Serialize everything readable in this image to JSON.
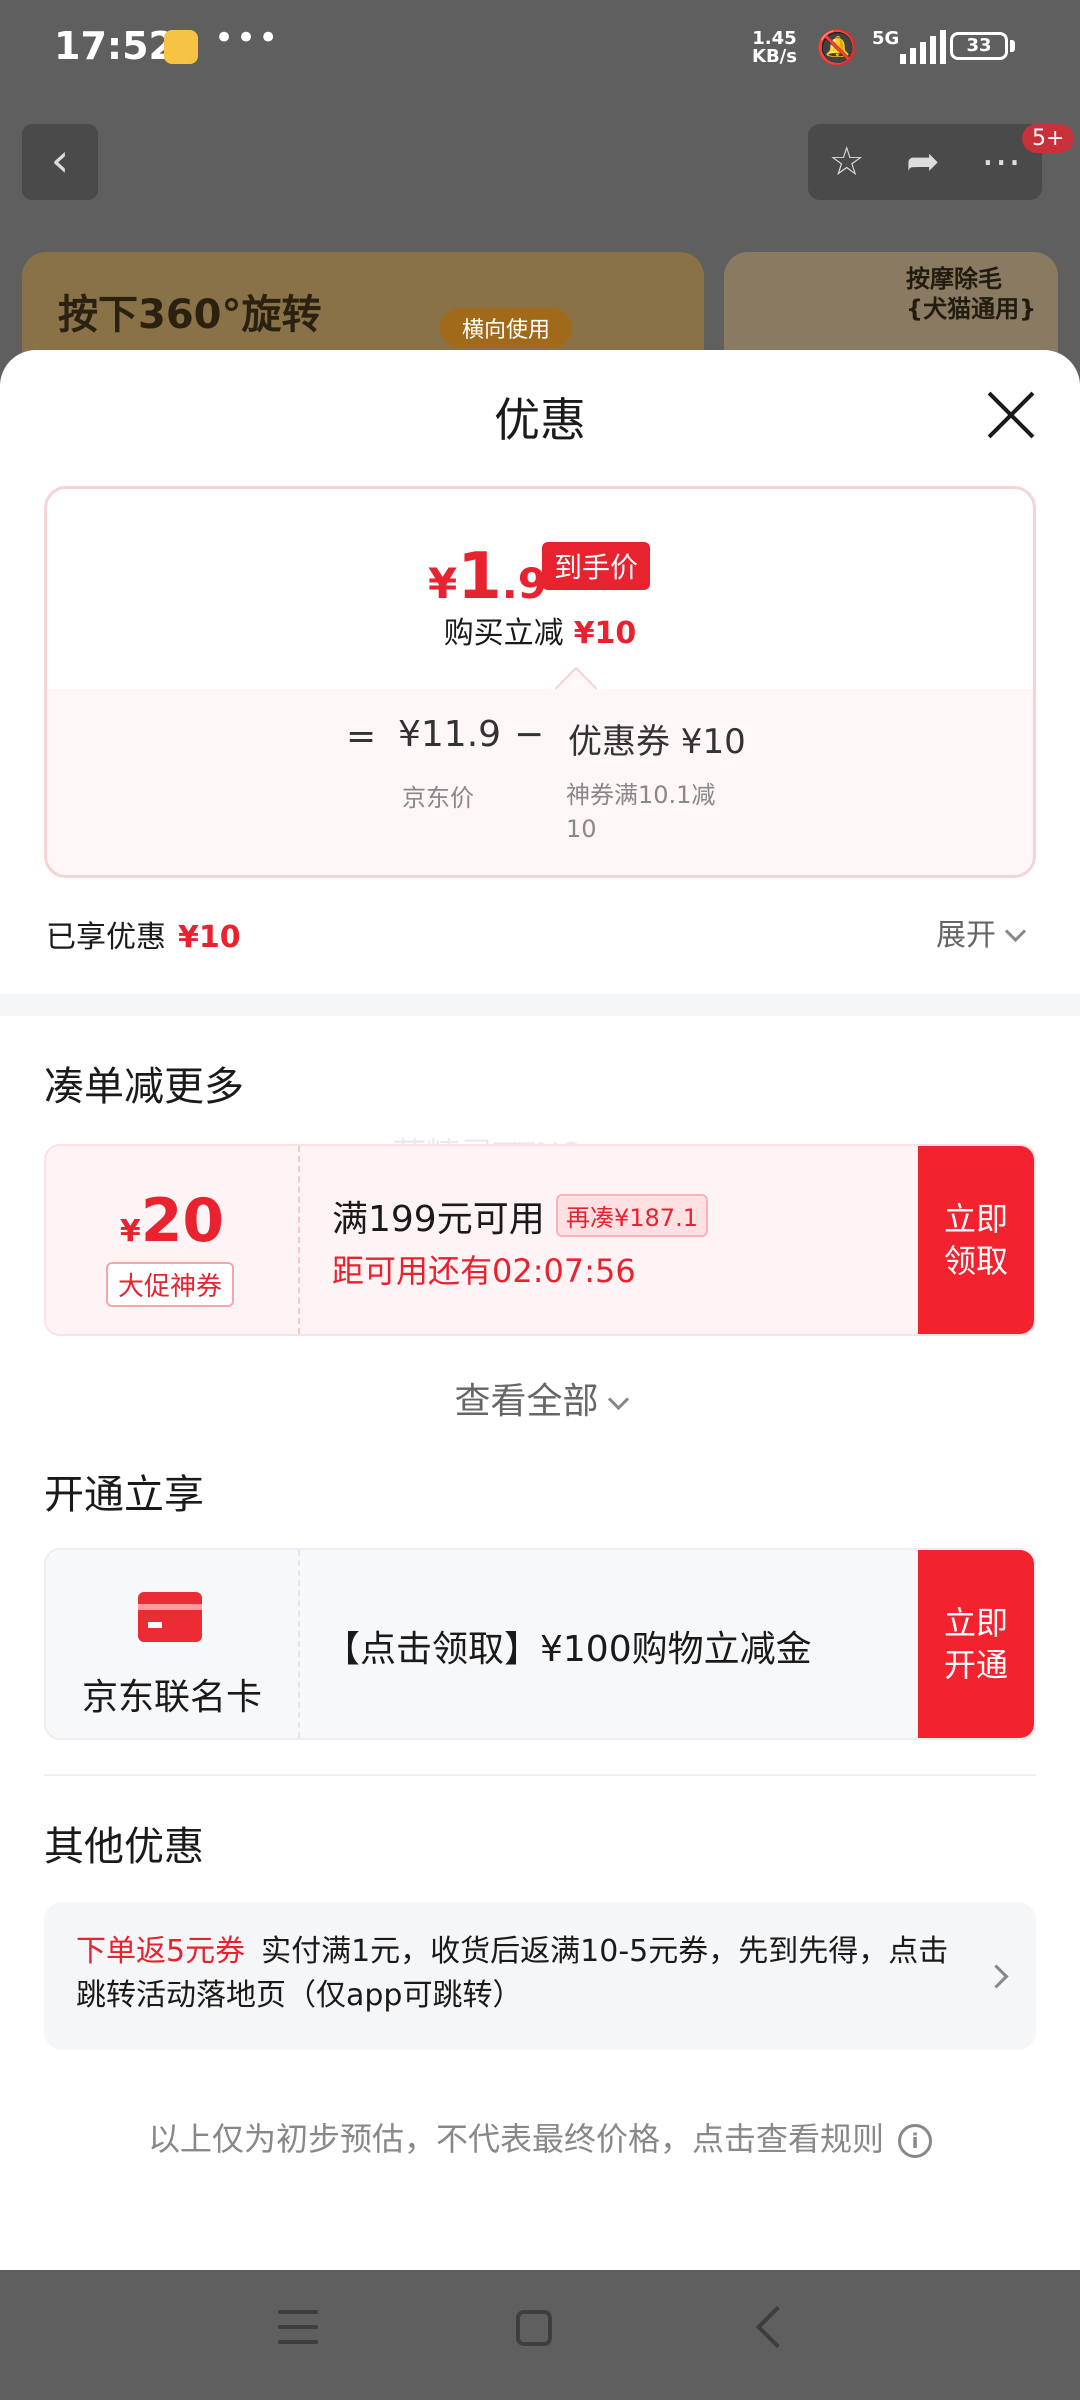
{
  "status_bar": {
    "time": "17:52",
    "net_speed_top": "1.45",
    "net_speed_bottom": "KB/s",
    "network": "5G",
    "battery": "33"
  },
  "background_page": {
    "banner_left_text": "按下360°旋转",
    "banner_left_tag": "横向使用",
    "banner_right_line1": "按摩除毛",
    "banner_right_line2": "{犬猫通用}",
    "notification_badge": "5+"
  },
  "sheet": {
    "title": "优惠",
    "final_price": {
      "currency": "¥",
      "integer": "1",
      "decimal": ".9",
      "tag": "到手价",
      "instant_cut_label": "购买立减",
      "instant_cut_value": "¥10"
    },
    "calc": {
      "equals": "=",
      "base_price": "¥11.9",
      "minus": "−",
      "coupon": "优惠券 ¥10",
      "base_price_label": "京东价",
      "coupon_desc": "神券满10.1减10"
    },
    "enjoyed_label": "已享优惠",
    "enjoyed_value": "¥10",
    "expand_label": "展开",
    "section_more": {
      "title": "凑单减更多",
      "coupon": {
        "currency": "¥",
        "amount": "20",
        "type": "大促神券",
        "condition": "满199元可用",
        "extra": "再凑¥187.1",
        "countdown": "距可用还有02:07:56",
        "button": "立即\n领取"
      },
      "view_all": "查看全部"
    },
    "watermark": "蓝精灵TTN8",
    "section_open": {
      "title": "开通立享",
      "card_name": "京东联名卡",
      "card_offer": "【点击领取】¥100购物立减金",
      "button": "立即\n开通"
    },
    "section_other": {
      "title": "其他优惠",
      "highlight": "下单返5元券",
      "text": "实付满1元，收货后返满10-5元券，先到先得，点击跳转活动落地页（仅app可跳转）"
    },
    "footnote": "以上仅为初步预估，不代表最终价格，点击查看规则"
  },
  "colors": {
    "accent_red": "#e8222e",
    "button_red": "#f2222f",
    "overlay_gray": "#5f5f5f"
  }
}
